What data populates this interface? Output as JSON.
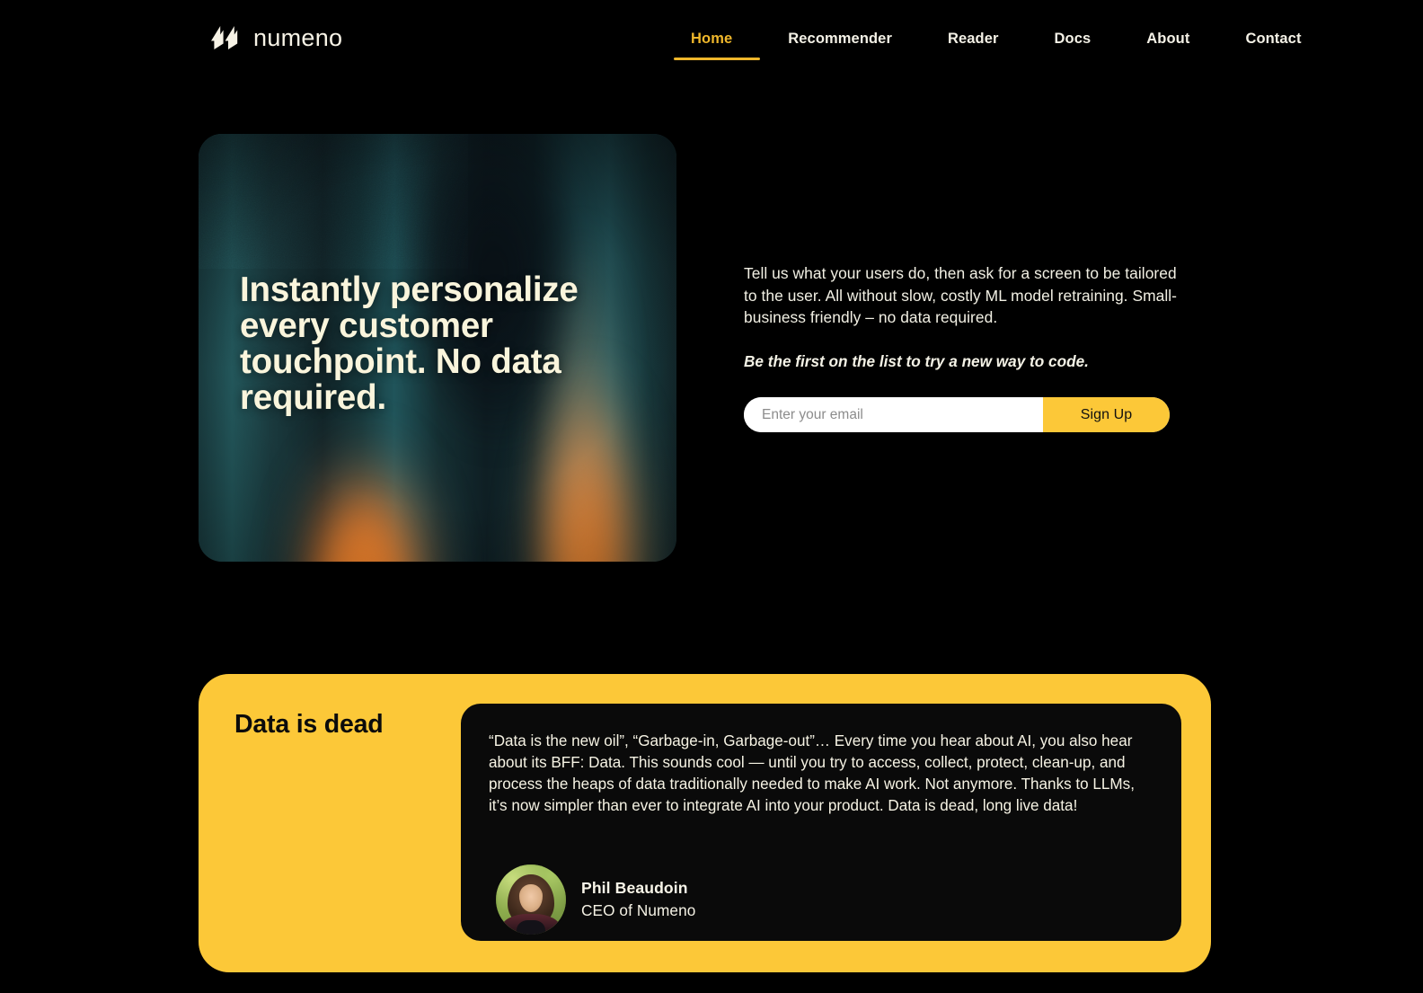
{
  "brand": {
    "name": "numeno",
    "logo_icon": "numeno-lightning-mark"
  },
  "nav": {
    "items": [
      {
        "label": "Home",
        "active": true
      },
      {
        "label": "Recommender",
        "active": false
      },
      {
        "label": "Reader",
        "active": false
      },
      {
        "label": "Docs",
        "active": false
      },
      {
        "label": "About",
        "active": false
      },
      {
        "label": "Contact",
        "active": false
      }
    ]
  },
  "hero": {
    "headline": "Instantly personalize every customer touchpoint. No data required.",
    "lead": "Tell us what your users do, then ask for a screen to be tailored to the user.  All without slow, costly ML model retraining.  Small-business friendly – no data required.",
    "subhead": "Be the first on the list to try a new way to code.",
    "signup": {
      "placeholder": "Enter your email",
      "value": "",
      "button_label": "Sign Up"
    }
  },
  "quote_section": {
    "heading": "Data is dead",
    "quote": "“Data is the new oil”, “Garbage-in, Garbage-out”… Every time you hear about AI, you also hear about its BFF: Data. This sounds cool — until you try to access, collect, protect, clean-up, and process the heaps of data traditionally needed to make AI work. Not anymore. Thanks to LLMs, it’s now simpler than ever to integrate AI into your product. Data is dead, long live data!",
    "author": {
      "name": "Phil Beaudoin",
      "role": "CEO of Numeno",
      "avatar_icon": "author-portrait-avatar"
    }
  },
  "colors": {
    "page_background": "#000000",
    "accent_yellow": "#FCC838",
    "nav_active": "#EFB72B",
    "cream_text": "#F6F3E4",
    "hero_teal": "#17383C",
    "hero_orange": "#F2822E",
    "card_black": "#0A0A0A"
  }
}
